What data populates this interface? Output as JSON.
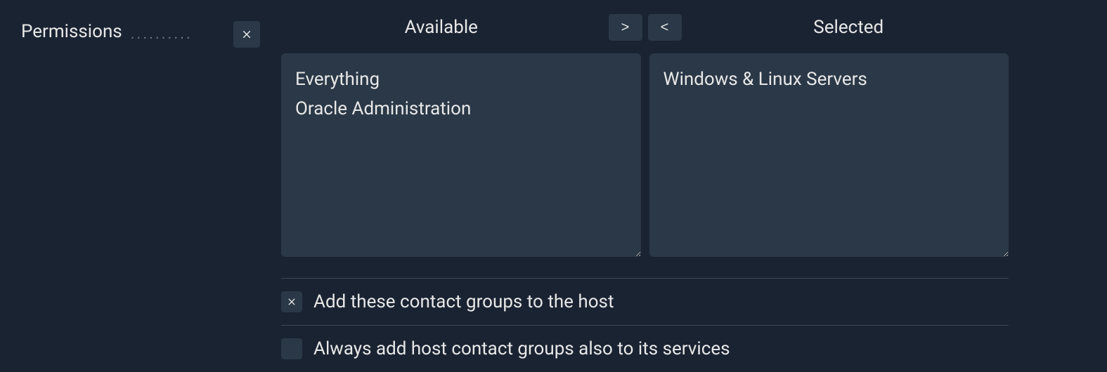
{
  "field": {
    "label": "Permissions"
  },
  "dual_list": {
    "available_label": "Available",
    "selected_label": "Selected",
    "move_right": ">",
    "move_left": "<",
    "available_items": [
      "Everything",
      "Oracle Administration"
    ],
    "selected_items": [
      "Windows & Linux Servers"
    ]
  },
  "checkboxes": [
    {
      "label": "Add these contact groups to the host",
      "checked": true
    },
    {
      "label": "Always add host contact groups also to its services",
      "checked": false
    }
  ]
}
